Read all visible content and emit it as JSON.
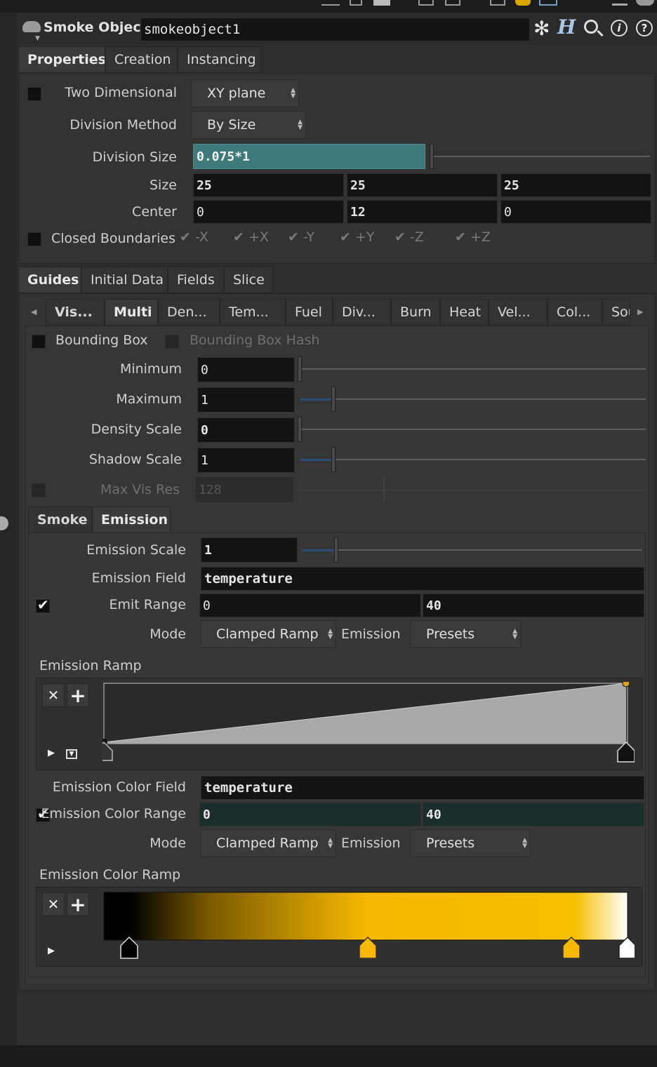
{
  "header": {
    "node_type": "Smoke Object",
    "node_name": "smokeobject1"
  },
  "top_tabs": [
    "Properties",
    "Creation",
    "Instancing"
  ],
  "properties": {
    "two_dimensional": {
      "label": "Two Dimensional",
      "value": "XY plane",
      "checked": false
    },
    "division_method": {
      "label": "Division Method",
      "value": "By Size"
    },
    "division_size": {
      "label": "Division Size",
      "value": "0.075*1"
    },
    "size": {
      "label": "Size",
      "values": [
        "25",
        "25",
        "25"
      ]
    },
    "center": {
      "label": "Center",
      "values": [
        "0",
        "12",
        "0"
      ]
    },
    "closed_boundaries": {
      "label": "Closed Boundaries",
      "checked": false,
      "axes": [
        "-X",
        "+X",
        "-Y",
        "+Y",
        "-Z",
        "+Z"
      ]
    }
  },
  "lower_tabs": [
    "Guides",
    "Initial Data",
    "Fields",
    "Slice"
  ],
  "guide_tabs": [
    "Vis...",
    "Multi",
    "Den...",
    "Tem...",
    "Fuel",
    "Div...",
    "Burn",
    "Heat",
    "Vel...",
    "Col...",
    "Sou"
  ],
  "guides": {
    "bounding_box": "Bounding Box",
    "bounding_box_hash": "Bounding Box Hash",
    "minimum": {
      "label": "Minimum",
      "value": "0"
    },
    "maximum": {
      "label": "Maximum",
      "value": "1"
    },
    "density_scale": {
      "label": "Density Scale",
      "value": "0"
    },
    "shadow_scale": {
      "label": "Shadow Scale",
      "value": "1"
    },
    "max_vis_res": {
      "label": "Max Vis Res",
      "value": "128"
    }
  },
  "sub_tabs": [
    "Smoke",
    "Emission"
  ],
  "emission": {
    "scale": {
      "label": "Emission Scale",
      "value": "1"
    },
    "field": {
      "label": "Emission Field",
      "value": "temperature"
    },
    "emit_range": {
      "label": "Emit Range",
      "values": [
        "0",
        "40"
      ],
      "checked": true
    },
    "mode": {
      "label": "Mode",
      "value": "Clamped Ramp",
      "emission_label": "Emission",
      "presets": "Presets"
    },
    "ramp_label": "Emission Ramp",
    "color_field": {
      "label": "Emission Color Field",
      "value": "temperature"
    },
    "color_range": {
      "label": "Emission Color Range",
      "values": [
        "0",
        "40"
      ],
      "checked": true
    },
    "color_mode": {
      "label": "Mode",
      "value": "Clamped Ramp",
      "emission_label": "Emission",
      "presets": "Presets"
    },
    "color_ramp_label": "Emission Color Ramp"
  },
  "colors": {
    "accent_teal": "#3e7a7a",
    "ramp_gold": "#f6b800",
    "key_dot": "#e0a020"
  }
}
